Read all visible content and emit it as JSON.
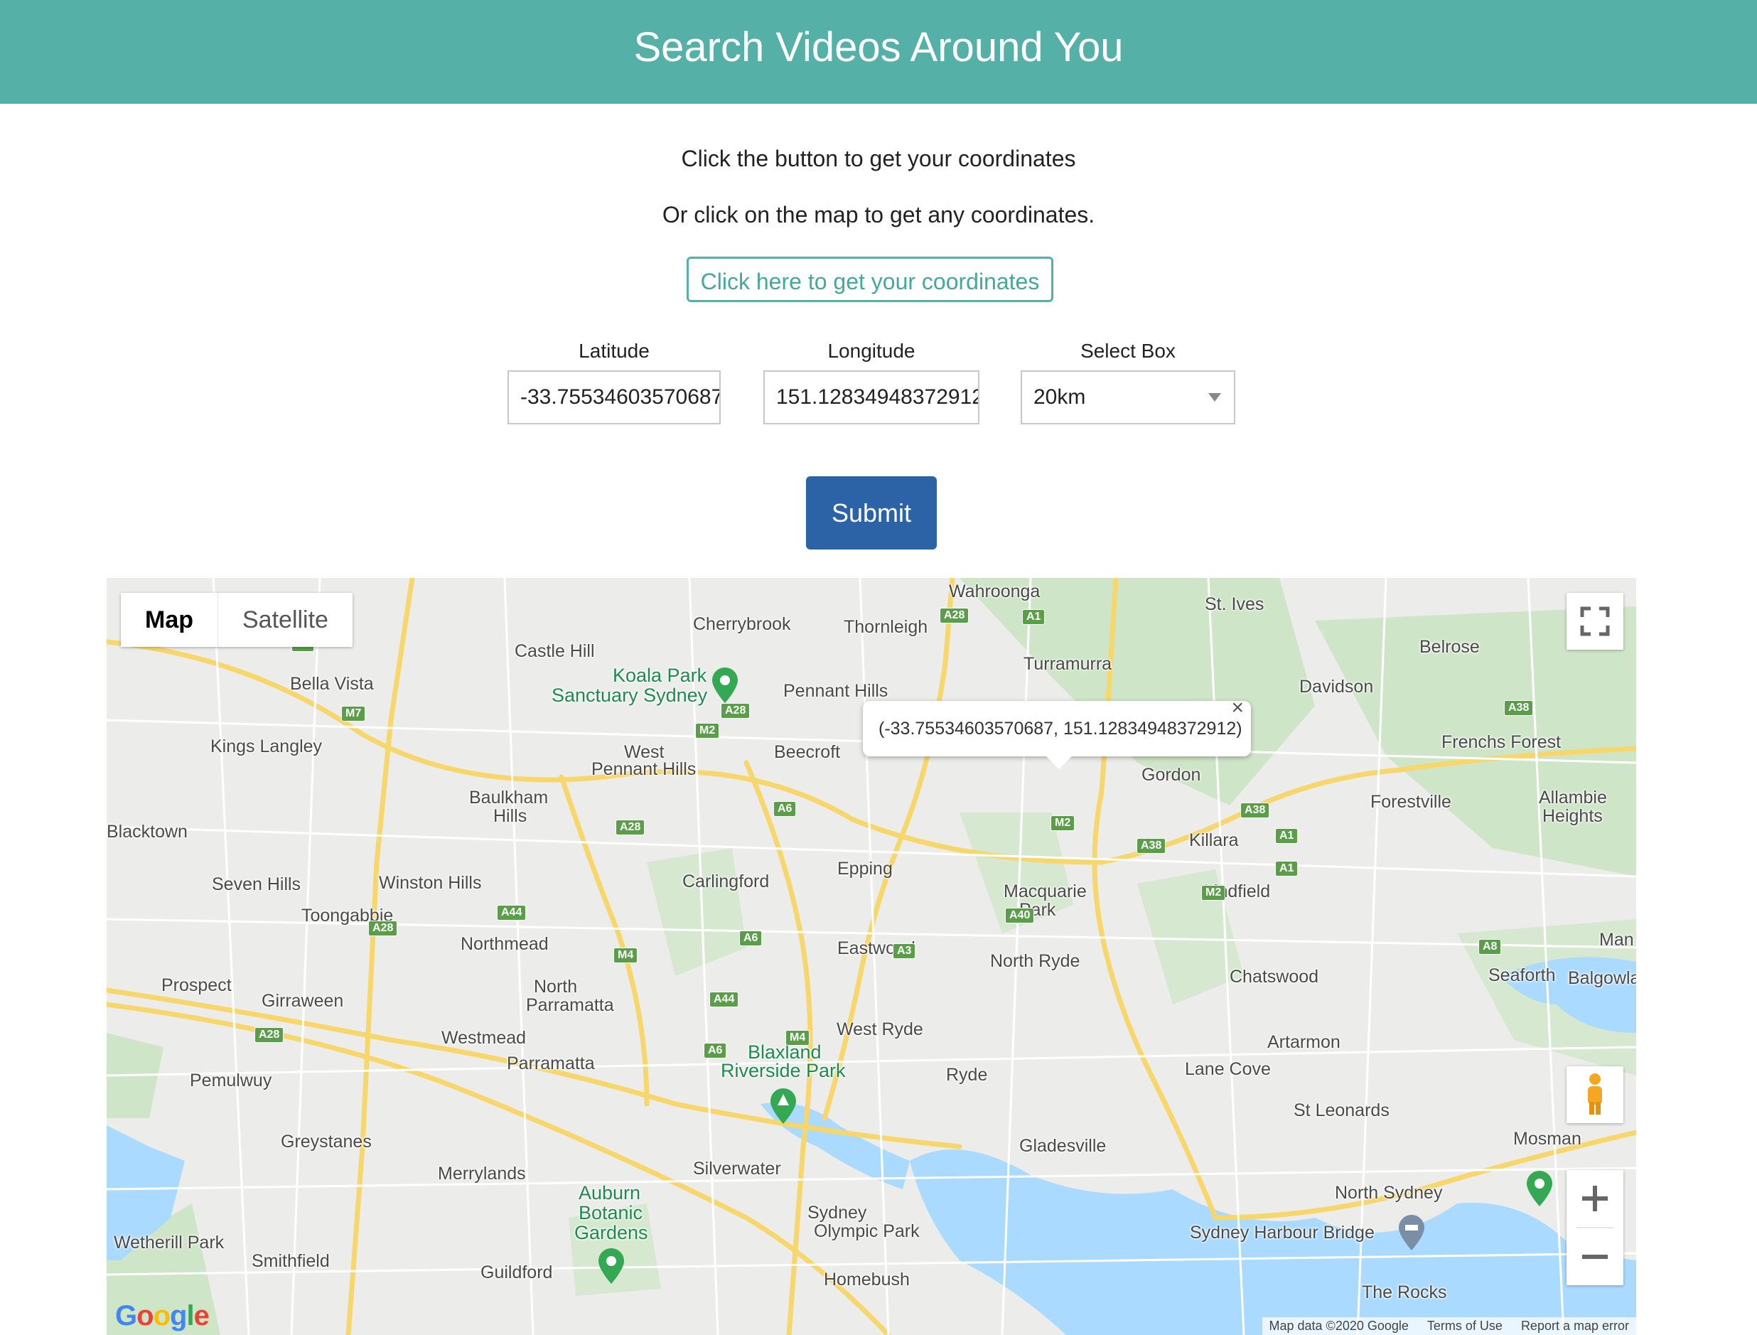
{
  "header": {
    "title": "Search Videos Around You"
  },
  "instructions": {
    "line1": "Click the button to get your coordinates",
    "line2": "Or click on the map to get any coordinates."
  },
  "coords_button": {
    "label": "Click here to get your coordinates"
  },
  "form": {
    "latitude_label": "Latitude",
    "latitude_value": "-33.75534603570687",
    "longitude_label": "Longitude",
    "longitude_value": "151.12834948372912",
    "select_label": "Select Box",
    "select_value": "20km",
    "submit_label": "Submit"
  },
  "map": {
    "type_controls": {
      "map": "Map",
      "satellite": "Satellite"
    },
    "info_window": "(-33.75534603570687, 151.12834948372912)",
    "places": [
      {
        "text": "Wahroonga",
        "kind": "suburb"
      },
      {
        "text": "St. Ives",
        "kind": "suburb"
      },
      {
        "text": "Cherrybrook",
        "kind": "suburb"
      },
      {
        "text": "Thornleigh",
        "kind": "suburb"
      },
      {
        "text": "Belrose",
        "kind": "suburb"
      },
      {
        "text": "Castle Hill",
        "kind": "suburb"
      },
      {
        "text": "Turramurra",
        "kind": "suburb"
      },
      {
        "text": "Koala Park",
        "kind": "park"
      },
      {
        "text": "Sanctuary Sydney",
        "kind": "park"
      },
      {
        "text": "Davidson",
        "kind": "suburb"
      },
      {
        "text": "Bella Vista",
        "kind": "suburb"
      },
      {
        "text": "Pennant Hills",
        "kind": "suburb"
      },
      {
        "text": "Frenchs Forest",
        "kind": "suburb"
      },
      {
        "text": "Kings Langley",
        "kind": "suburb"
      },
      {
        "text": "West",
        "kind": "suburb"
      },
      {
        "text": "Pennant Hills",
        "kind": "suburb"
      },
      {
        "text": "Beecroft",
        "kind": "suburb"
      },
      {
        "text": "Gordon",
        "kind": "suburb"
      },
      {
        "text": "Baulkham",
        "kind": "suburb"
      },
      {
        "text": "Hills",
        "kind": "suburb"
      },
      {
        "text": "Forestville",
        "kind": "suburb"
      },
      {
        "text": "Allambie",
        "kind": "suburb"
      },
      {
        "text": "Heights",
        "kind": "suburb"
      },
      {
        "text": "Blacktown",
        "kind": "suburb"
      },
      {
        "text": "Killara",
        "kind": "suburb"
      },
      {
        "text": "Epping",
        "kind": "suburb"
      },
      {
        "text": "Carlingford",
        "kind": "suburb"
      },
      {
        "text": "Seven Hills",
        "kind": "suburb"
      },
      {
        "text": "Winston Hills",
        "kind": "suburb"
      },
      {
        "text": "Lindfield",
        "kind": "suburb"
      },
      {
        "text": "Macquarie",
        "kind": "suburb"
      },
      {
        "text": "Park",
        "kind": "suburb"
      },
      {
        "text": "Toongabbie",
        "kind": "suburb"
      },
      {
        "text": "Man",
        "kind": "suburb"
      },
      {
        "text": "Northmead",
        "kind": "suburb"
      },
      {
        "text": "Eastwood",
        "kind": "suburb"
      },
      {
        "text": "North Ryde",
        "kind": "suburb"
      },
      {
        "text": "Chatswood",
        "kind": "suburb"
      },
      {
        "text": "Seaforth",
        "kind": "suburb"
      },
      {
        "text": "Balgowla",
        "kind": "suburb"
      },
      {
        "text": "Prospect",
        "kind": "suburb"
      },
      {
        "text": "North",
        "kind": "suburb"
      },
      {
        "text": "Parramatta",
        "kind": "suburb"
      },
      {
        "text": "Girraween",
        "kind": "suburb"
      },
      {
        "text": "West Ryde",
        "kind": "suburb"
      },
      {
        "text": "Westmead",
        "kind": "suburb"
      },
      {
        "text": "Artarmon",
        "kind": "suburb"
      },
      {
        "text": "Blaxland",
        "kind": "park"
      },
      {
        "text": "Parramatta",
        "kind": "suburb"
      },
      {
        "text": "Riverside Park",
        "kind": "park"
      },
      {
        "text": "Lane Cove",
        "kind": "suburb"
      },
      {
        "text": "Ryde",
        "kind": "suburb"
      },
      {
        "text": "Pemulwuy",
        "kind": "suburb"
      },
      {
        "text": "St Leonards",
        "kind": "suburb"
      },
      {
        "text": "Greystanes",
        "kind": "suburb"
      },
      {
        "text": "Gladesville",
        "kind": "suburb"
      },
      {
        "text": "Mosman",
        "kind": "suburb"
      },
      {
        "text": "Silverwater",
        "kind": "suburb"
      },
      {
        "text": "Merrylands",
        "kind": "suburb"
      },
      {
        "text": "Auburn",
        "kind": "park"
      },
      {
        "text": "North Sydney",
        "kind": "suburb"
      },
      {
        "text": "Botanic",
        "kind": "park"
      },
      {
        "text": "Sydney",
        "kind": "suburb"
      },
      {
        "text": "Gardens",
        "kind": "park"
      },
      {
        "text": "Olympic Park",
        "kind": "suburb"
      },
      {
        "text": "Sydney Harbour Bridge",
        "kind": "suburb"
      },
      {
        "text": "Wetherill Park",
        "kind": "suburb"
      },
      {
        "text": "Smithfield",
        "kind": "suburb"
      },
      {
        "text": "Guildford",
        "kind": "suburb"
      },
      {
        "text": "Homebush",
        "kind": "suburb"
      },
      {
        "text": "The Rocks",
        "kind": "suburb"
      }
    ],
    "shields": [
      "A28",
      "A1",
      "A2",
      "M7",
      "A28",
      "M2",
      "A3",
      "A1",
      "A38",
      "A6",
      "A28",
      "M2",
      "A38",
      "A38",
      "A1",
      "A1",
      "A44",
      "A28",
      "M2",
      "A40",
      "A6",
      "M4",
      "A3",
      "A44",
      "M4",
      "A28",
      "A8",
      "A6"
    ],
    "attribution": {
      "data": "Map data ©2020 Google",
      "terms": "Terms of Use",
      "report": "Report a map error"
    },
    "logo": "Google"
  }
}
